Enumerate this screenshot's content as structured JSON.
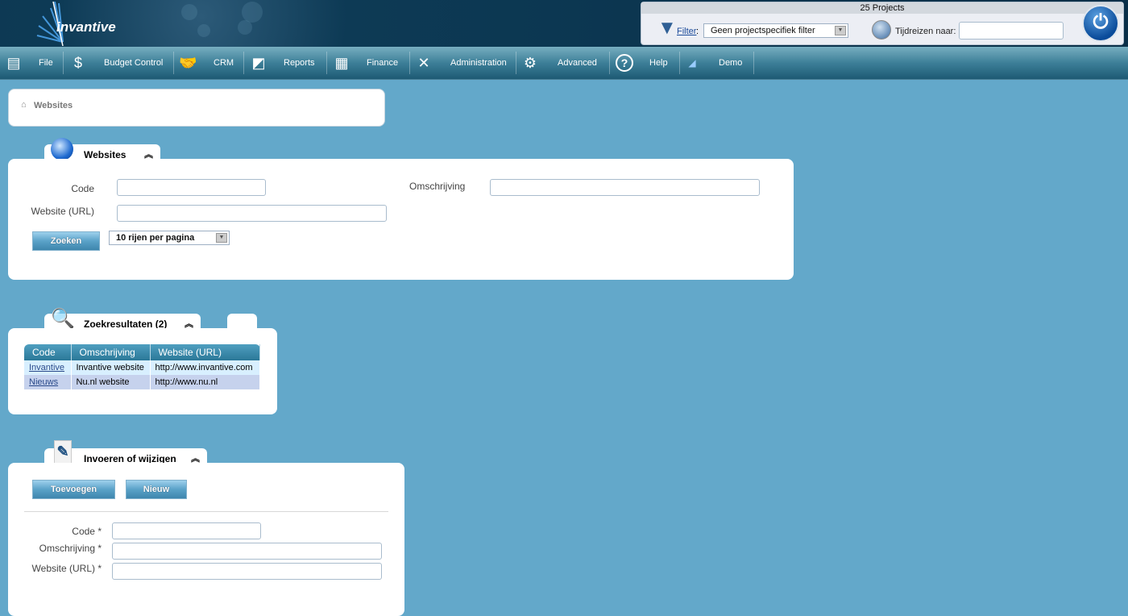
{
  "app": {
    "logo_text": "invantive",
    "brand_color": "#0d3a55",
    "background": "#63a8ca"
  },
  "topbar": {
    "projects_count": "25 Projects",
    "filter_link": "Filter",
    "filter_colon": ":",
    "filter_value": "Geen projectspecifiek filter",
    "timetravel_label": "Tijdreizen naar:",
    "timetravel_value": "",
    "power_icon": "power-icon"
  },
  "menu": {
    "items": [
      {
        "label": "File",
        "icon": "file-cabinet-icon"
      },
      {
        "label": "Budget Control",
        "icon": "money-bag-icon"
      },
      {
        "label": "CRM",
        "icon": "handshake-icon"
      },
      {
        "label": "Reports",
        "icon": "presentation-icon"
      },
      {
        "label": "Finance",
        "icon": "calculator-icon"
      },
      {
        "label": "Administration",
        "icon": "tools-icon"
      },
      {
        "label": "Advanced",
        "icon": "gears-icon"
      },
      {
        "label": "Help",
        "icon": "help-icon"
      },
      {
        "label": "Demo",
        "icon": "invantive-logo-icon"
      }
    ]
  },
  "breadcrumb": {
    "label": "Websites"
  },
  "search_panel": {
    "title": "Websites",
    "code_label": "Code",
    "code_value": "",
    "url_label": "Website (URL)",
    "url_value": "",
    "desc_label": "Omschrijving",
    "desc_value": "",
    "search_button": "Zoeken",
    "page_size": "10 rijen per pagina"
  },
  "results_panel": {
    "title": "Zoekresultaten (2)",
    "columns": [
      "Code",
      "Omschrijving",
      "Website (URL)"
    ],
    "rows": [
      [
        "Invantive",
        "Invantive website",
        "http://www.invantive.com"
      ],
      [
        "Nieuws",
        "Nu.nl website",
        "http://www.nu.nl"
      ]
    ]
  },
  "edit_panel": {
    "title": "Invoeren of wijzigen",
    "add_button": "Toevoegen",
    "new_button": "Nieuw",
    "code_label": "Code *",
    "code_value": "",
    "desc_label": "Omschrijving *",
    "desc_value": "",
    "url_label": "Website (URL) *",
    "url_value": ""
  }
}
